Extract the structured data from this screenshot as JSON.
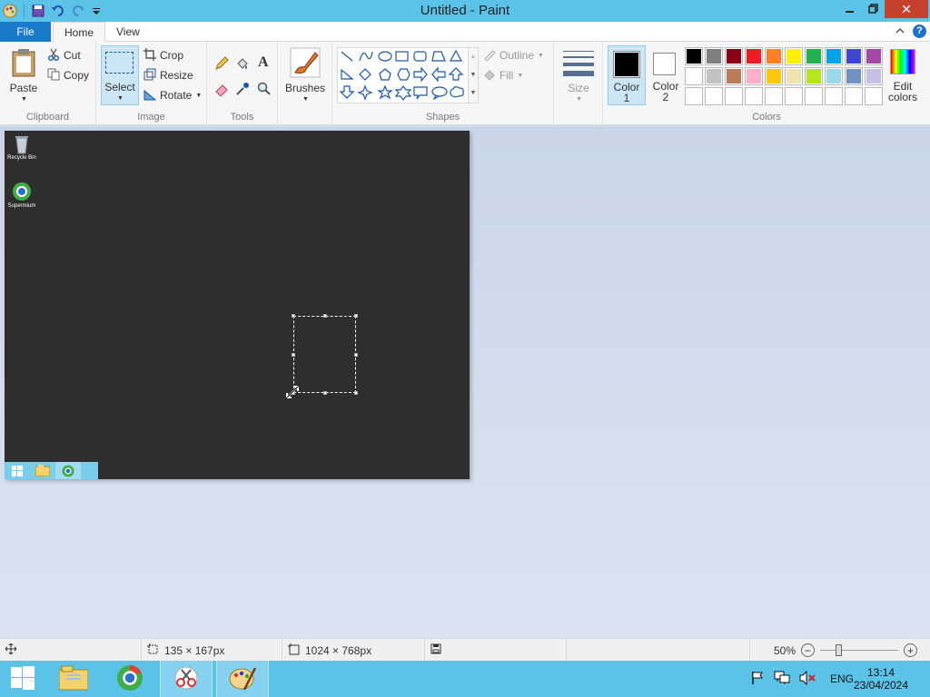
{
  "window": {
    "title": "Untitled - Paint",
    "help": "?"
  },
  "tabs": [
    {
      "label": "File"
    },
    {
      "label": "Home"
    },
    {
      "label": "View"
    }
  ],
  "ribbon": {
    "clipboard": {
      "paste": "Paste",
      "cut": "Cut",
      "copy": "Copy",
      "group": "Clipboard"
    },
    "image": {
      "select": "Select",
      "crop": "Crop",
      "resize": "Resize",
      "rotate": "Rotate",
      "group": "Image"
    },
    "tools": {
      "group": "Tools",
      "text_glyph": "A"
    },
    "brushes": {
      "label": "Brushes"
    },
    "shapes": {
      "outline": "Outline",
      "fill": "Fill",
      "group": "Shapes"
    },
    "size": {
      "label": "Size"
    },
    "colors": {
      "color1_l1": "Color",
      "color1_l2": "1",
      "color2_l1": "Color",
      "color2_l2": "2",
      "edit_l1": "Edit",
      "edit_l2": "colors",
      "group": "Colors",
      "color1": "#000000",
      "color2": "#ffffff",
      "palette_row1": [
        "#000000",
        "#7f7f7f",
        "#880015",
        "#ed1c24",
        "#ff7f27",
        "#fff200",
        "#22b14c",
        "#00a2e8",
        "#3f48cc",
        "#a349a4"
      ],
      "palette_row2": [
        "#ffffff",
        "#c3c3c3",
        "#b97a57",
        "#ffaec9",
        "#ffc90e",
        "#efe4b0",
        "#b5e61d",
        "#99d9ea",
        "#7092be",
        "#c8bfe7"
      ]
    }
  },
  "canvas": {
    "background": "#2e2e2e",
    "desktop_icons": [
      {
        "label": "Recycle Bin",
        "icon": "recycle-bin-icon"
      },
      {
        "label": "Supermium",
        "icon": "supermium-icon"
      }
    ]
  },
  "status": {
    "selection_size": "135 × 167px",
    "canvas_size": "1024 × 768px",
    "zoom": "50%"
  },
  "taskbar": {
    "lang": "ENG",
    "time": "13:14",
    "date": "23/04/2024"
  }
}
